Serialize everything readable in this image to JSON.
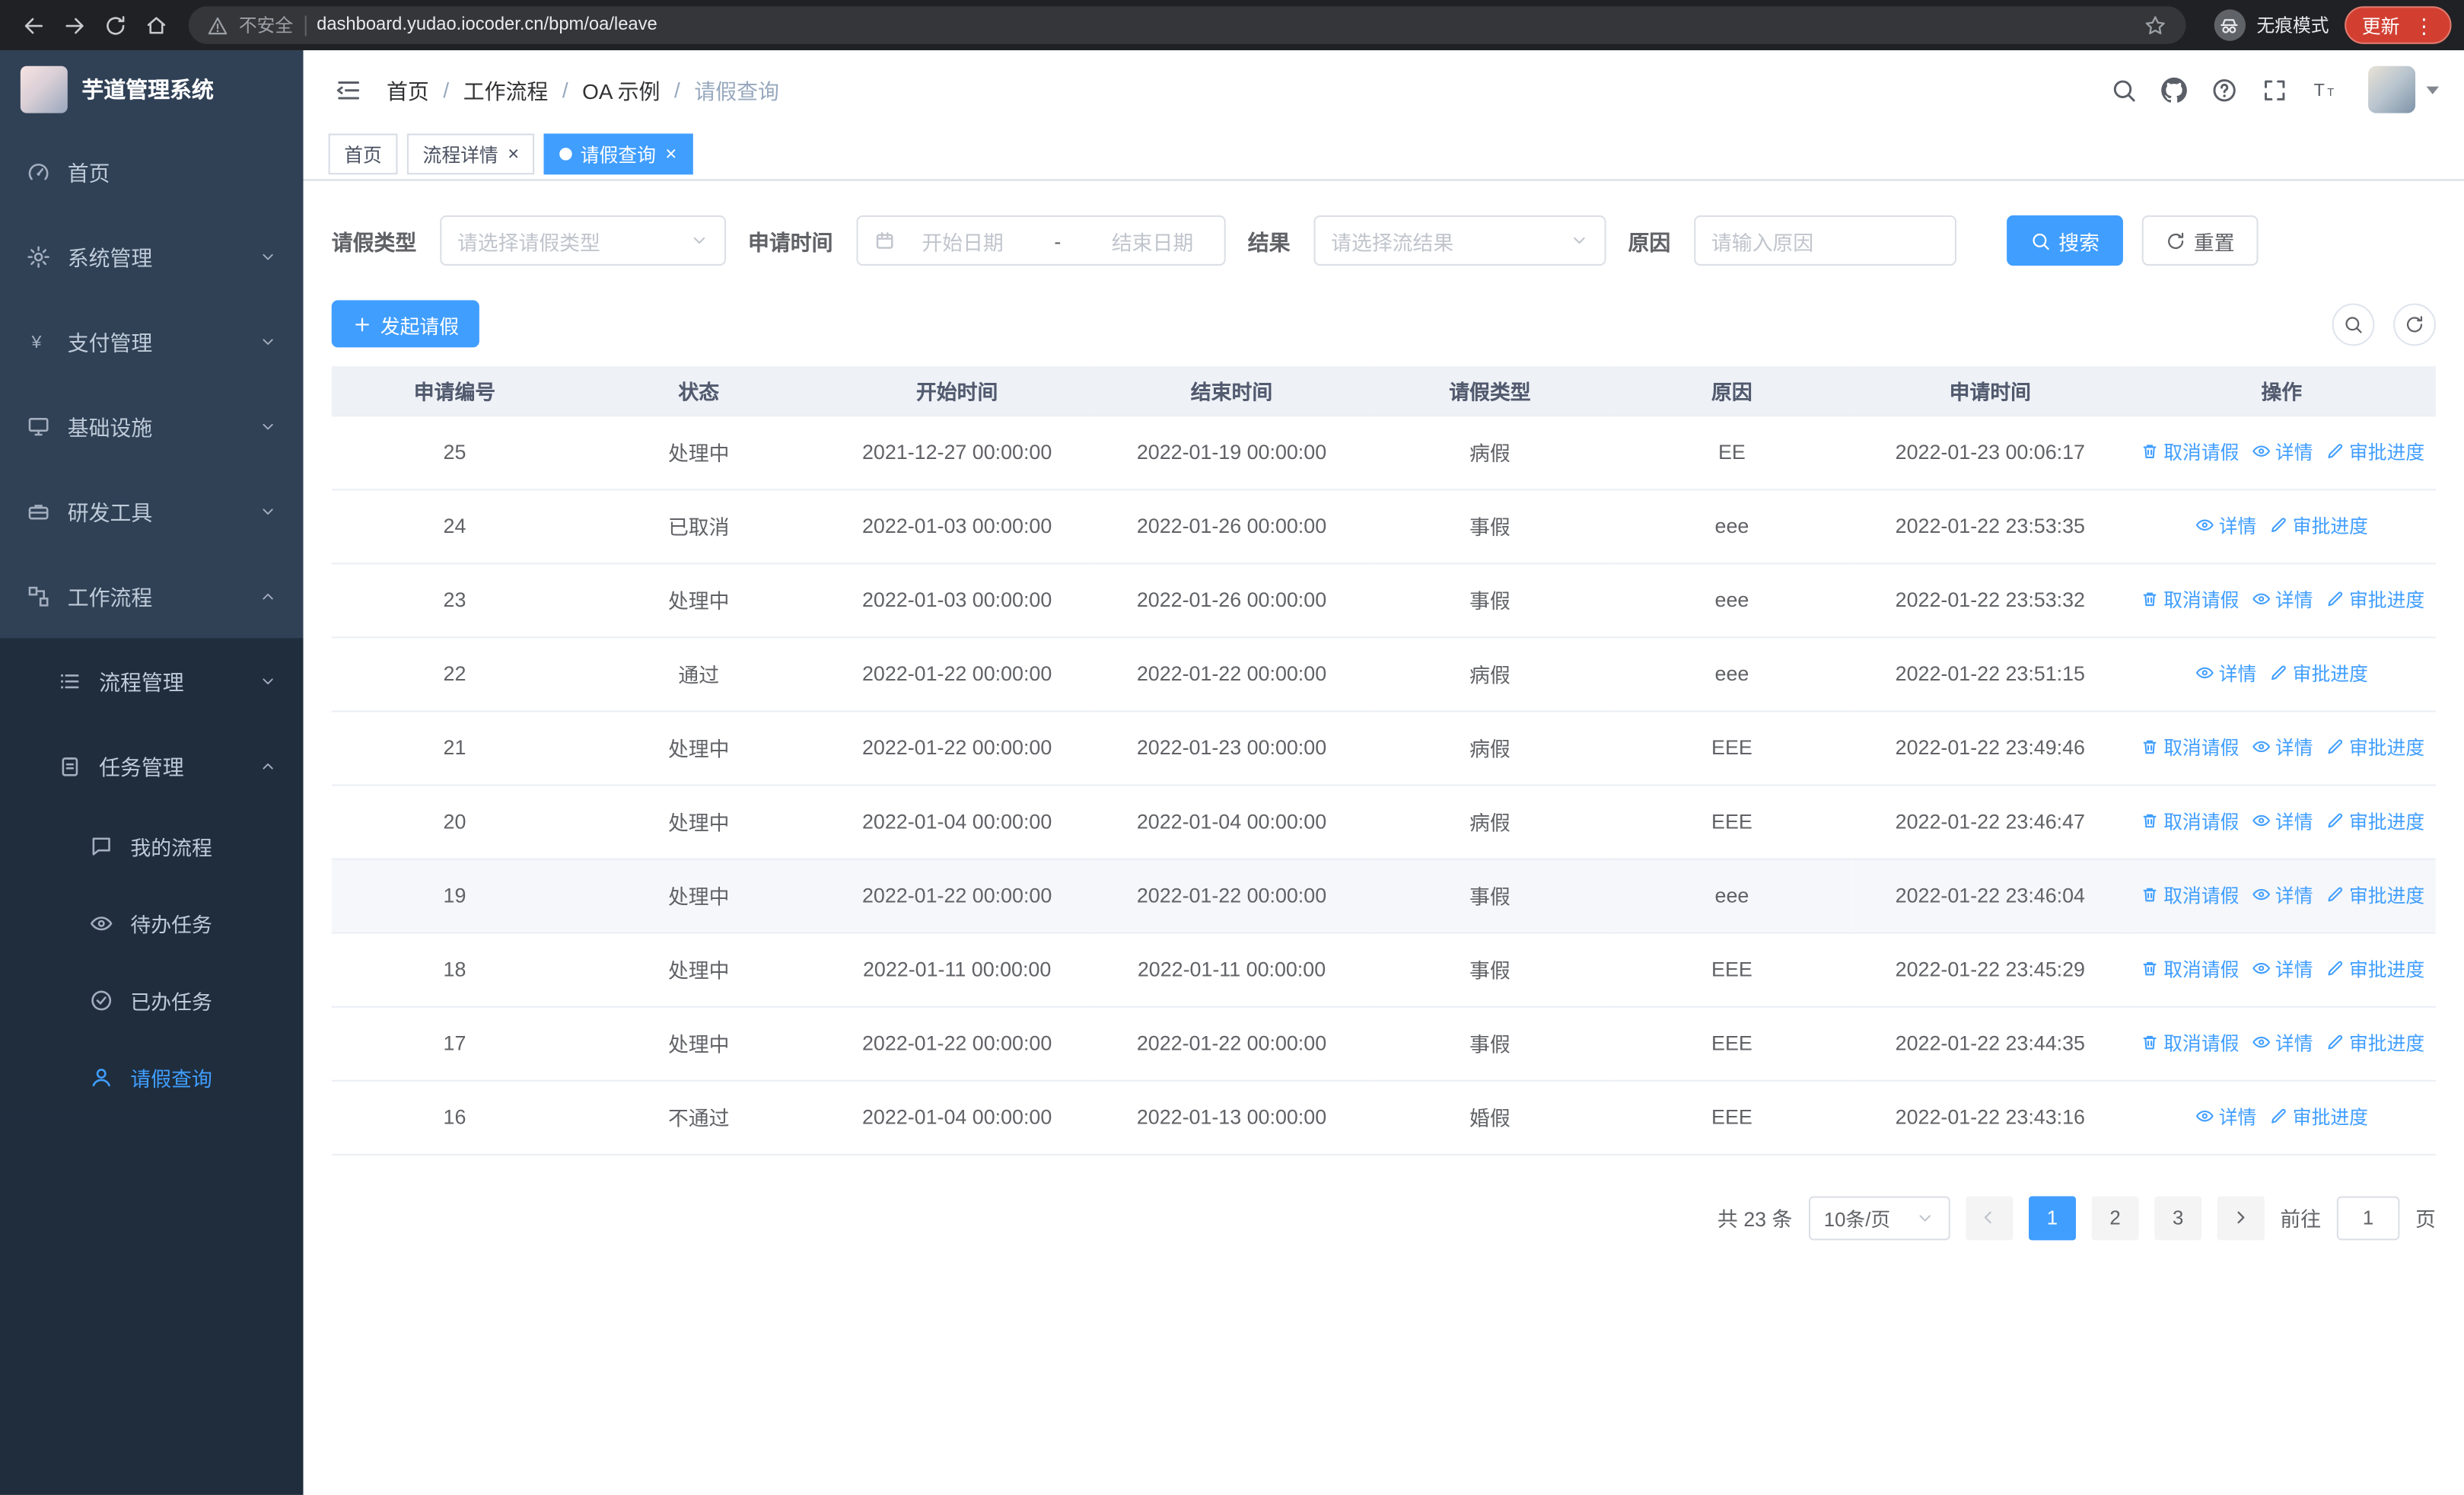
{
  "browser": {
    "security_label": "不安全",
    "url": "dashboard.yudao.iocoder.cn/bpm/oa/leave",
    "incognito_label": "无痕模式",
    "update_label": "更新"
  },
  "icons": {
    "close": "×",
    "kebab": "⋮"
  },
  "colors": {
    "accent": "#409eff",
    "sidebar_bg": "#304156",
    "submenu_bg": "#1f2d3d",
    "update_pill": "#d23f31"
  },
  "sidebar": {
    "logo_title": "芋道管理系统",
    "items": [
      {
        "label": "首页"
      },
      {
        "label": "系统管理"
      },
      {
        "label": "支付管理"
      },
      {
        "label": "基础设施"
      },
      {
        "label": "研发工具"
      },
      {
        "label": "工作流程"
      },
      {
        "label": "流程管理"
      },
      {
        "label": "任务管理"
      },
      {
        "label": "我的流程"
      },
      {
        "label": "待办任务"
      },
      {
        "label": "已办任务"
      },
      {
        "label": "请假查询"
      }
    ]
  },
  "breadcrumb": {
    "separator": "/",
    "items": [
      "首页",
      "工作流程",
      "OA 示例",
      "请假查询"
    ]
  },
  "tabs": [
    {
      "label": "首页"
    },
    {
      "label": "流程详情"
    },
    {
      "label": "请假查询"
    }
  ],
  "filters": {
    "leave_type_label": "请假类型",
    "leave_type_placeholder": "请选择请假类型",
    "apply_time_label": "申请时间",
    "date_start_placeholder": "开始日期",
    "date_separator": "-",
    "date_end_placeholder": "结束日期",
    "result_label": "结果",
    "result_placeholder": "请选择流结果",
    "reason_label": "原因",
    "reason_placeholder": "请输入原因",
    "search_label": "搜索",
    "reset_label": "重置"
  },
  "toolbar": {
    "create_label": "发起请假"
  },
  "table": {
    "columns": [
      "申请编号",
      "状态",
      "开始时间",
      "结束时间",
      "请假类型",
      "原因",
      "申请时间",
      "操作"
    ],
    "action_labels": {
      "cancel": "取消请假",
      "detail": "详情",
      "progress": "审批进度"
    },
    "rows": [
      {
        "id": "25",
        "status": "处理中",
        "start": "2021-12-27 00:00:00",
        "end": "2022-01-19 00:00:00",
        "type": "病假",
        "reason": "EE",
        "applied": "2022-01-23 00:06:17",
        "actions": [
          "cancel",
          "detail",
          "progress"
        ]
      },
      {
        "id": "24",
        "status": "已取消",
        "start": "2022-01-03 00:00:00",
        "end": "2022-01-26 00:00:00",
        "type": "事假",
        "reason": "eee",
        "applied": "2022-01-22 23:53:35",
        "actions": [
          "detail",
          "progress"
        ]
      },
      {
        "id": "23",
        "status": "处理中",
        "start": "2022-01-03 00:00:00",
        "end": "2022-01-26 00:00:00",
        "type": "事假",
        "reason": "eee",
        "applied": "2022-01-22 23:53:32",
        "actions": [
          "cancel",
          "detail",
          "progress"
        ]
      },
      {
        "id": "22",
        "status": "通过",
        "start": "2022-01-22 00:00:00",
        "end": "2022-01-22 00:00:00",
        "type": "病假",
        "reason": "eee",
        "applied": "2022-01-22 23:51:15",
        "actions": [
          "detail",
          "progress"
        ]
      },
      {
        "id": "21",
        "status": "处理中",
        "start": "2022-01-22 00:00:00",
        "end": "2022-01-23 00:00:00",
        "type": "病假",
        "reason": "EEE",
        "applied": "2022-01-22 23:49:46",
        "actions": [
          "cancel",
          "detail",
          "progress"
        ]
      },
      {
        "id": "20",
        "status": "处理中",
        "start": "2022-01-04 00:00:00",
        "end": "2022-01-04 00:00:00",
        "type": "病假",
        "reason": "EEE",
        "applied": "2022-01-22 23:46:47",
        "actions": [
          "cancel",
          "detail",
          "progress"
        ]
      },
      {
        "id": "19",
        "status": "处理中",
        "start": "2022-01-22 00:00:00",
        "end": "2022-01-22 00:00:00",
        "type": "事假",
        "reason": "eee",
        "applied": "2022-01-22 23:46:04",
        "actions": [
          "cancel",
          "detail",
          "progress"
        ],
        "highlighted": true
      },
      {
        "id": "18",
        "status": "处理中",
        "start": "2022-01-11 00:00:00",
        "end": "2022-01-11 00:00:00",
        "type": "事假",
        "reason": "EEE",
        "applied": "2022-01-22 23:45:29",
        "actions": [
          "cancel",
          "detail",
          "progress"
        ]
      },
      {
        "id": "17",
        "status": "处理中",
        "start": "2022-01-22 00:00:00",
        "end": "2022-01-22 00:00:00",
        "type": "事假",
        "reason": "EEE",
        "applied": "2022-01-22 23:44:35",
        "actions": [
          "cancel",
          "detail",
          "progress"
        ]
      },
      {
        "id": "16",
        "status": "不通过",
        "start": "2022-01-04 00:00:00",
        "end": "2022-01-13 00:00:00",
        "type": "婚假",
        "reason": "EEE",
        "applied": "2022-01-22 23:43:16",
        "actions": [
          "detail",
          "progress"
        ]
      }
    ]
  },
  "pagination": {
    "total_text": "共 23 条",
    "page_size_label": "10条/页",
    "pages": [
      "1",
      "2",
      "3"
    ],
    "active_page": "1",
    "goto_label": "前往",
    "goto_value": "1",
    "goto_unit": "页"
  }
}
